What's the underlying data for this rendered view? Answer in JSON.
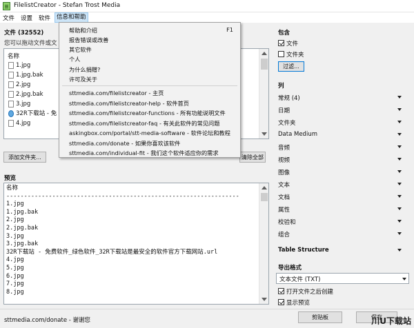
{
  "window": {
    "title": "FilelistCreator - Stefan Trost Media"
  },
  "menubar": [
    "文件",
    "设置",
    "软件",
    "信息和帮助"
  ],
  "files": {
    "header": "文件 (32552)",
    "hint": "您可以拖动文件或文",
    "column": "名称",
    "items": [
      {
        "name": "1.jpg",
        "icon": "file-icon"
      },
      {
        "name": "1.jpg.bak",
        "icon": "file-icon"
      },
      {
        "name": "2.jpg",
        "icon": "file-icon"
      },
      {
        "name": "2.jpg.bak",
        "icon": "file-icon"
      },
      {
        "name": "3.jpg",
        "icon": "file-icon"
      },
      {
        "name": "32R下载站 - 免",
        "icon": "globe-icon"
      },
      {
        "name": "4.jpg",
        "icon": "file-icon"
      }
    ],
    "add_files_btn": "添加文件夹...",
    "clear_all_btn": "清除全部"
  },
  "help_menu": {
    "items": [
      {
        "label": "帮助和介绍",
        "shortcut": "F1"
      },
      {
        "label": "报告错误或改善",
        "shortcut": ""
      },
      {
        "label": "其它软件",
        "shortcut": ""
      },
      {
        "label": "个人",
        "shortcut": ""
      },
      {
        "label": "为什么捐赠?",
        "shortcut": ""
      },
      {
        "label": "许可及关于",
        "shortcut": ""
      }
    ],
    "links": [
      "sttmedia.com/filelistcreator - 主页",
      "sttmedia.com/filelistcreator-help - 软件首页",
      "sttmedia.com/filelistcreator-functions - 所有功能说明文件",
      "sttmedia.com/filelistcreator-faq - 有关此软件的常见问题",
      "askingbox.com/portal/stt-media-software - 软件论坛和教程",
      "sttmedia.com/donate - 如果你喜欢该软件",
      "sttmedia.com/individual-fit - 我们这个软件适应你的需求"
    ]
  },
  "preview": {
    "label": "预览",
    "lines": [
      "名称",
      "------------------------------------------------------------------",
      "1.jpg",
      "1.jpg.bak",
      "2.jpg",
      "2.jpg.bak",
      "3.jpg",
      "3.jpg.bak",
      "32R下载站 - 免费软件_绿色软件_32R下载站是最安全的软件官方下载网站.url",
      "4.jpg",
      "5.jpg",
      "6.jpg",
      "7.jpg",
      "8.jpg"
    ]
  },
  "include": {
    "label": "包含",
    "files_label": "文件",
    "files_checked": true,
    "folders_label": "文件夹",
    "folders_checked": false,
    "filter_btn": "过滤..."
  },
  "columns": {
    "label": "列",
    "items": [
      "常规 (4)",
      "日期",
      "文件夹",
      "Data Medium",
      "音频",
      "视频",
      "图像",
      "文本",
      "文档",
      "属性",
      "校验和",
      "组合"
    ],
    "table_structure": "Table Structure"
  },
  "export": {
    "label": "导出格式",
    "format": "文本文件 (TXT)",
    "open_after_label": "打开文件之后创建",
    "open_after_checked": true,
    "show_preview_label": "显示预览",
    "show_preview_checked": true
  },
  "statusbar": {
    "text": "sttmedia.com/donate - 谢谢您",
    "clipboard_btn": "剪贴板",
    "save_btn": "保存"
  },
  "watermark": "川U下载站"
}
